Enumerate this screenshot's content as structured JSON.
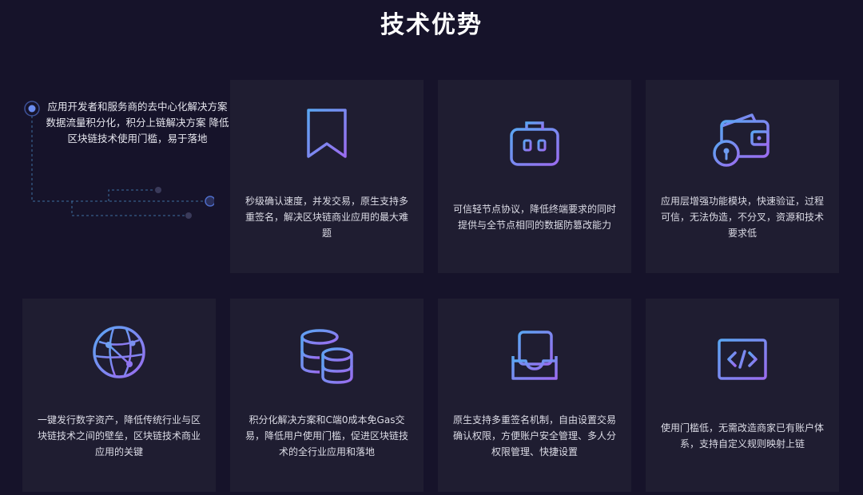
{
  "title": "技术优势",
  "intro": "应用开发者和服务商的去中心化解决方案 数据流量积分化，积分上链解决方案 降低区块链技术使用门槛，易于落地",
  "cards": [
    {
      "icon": "bookmark-icon",
      "text": "秒级确认速度，并发交易，原生支持多重签名，解决区块链商业应用的最大难题"
    },
    {
      "icon": "briefcase-icon",
      "text": "可信轻节点协议，降低终端要求的同时提供与全节点相同的数据防篡改能力"
    },
    {
      "icon": "wallet-lock-icon",
      "text": "应用层增强功能模块，快速验证，过程可信，无法伪造，不分叉，资源和技术要求低"
    },
    {
      "icon": "globe-network-icon",
      "text": "一键发行数字资产，降低传统行业与区块链技术之间的壁垒，区块链技术商业应用的关键"
    },
    {
      "icon": "database-icon",
      "text": "积分化解决方案和C端0成本免Gas交易，降低用户使用门槛，促进区块链技术的全行业应用和落地"
    },
    {
      "icon": "inbox-document-icon",
      "text": "原生支持多重签名机制，自由设置交易确认权限，方便账户安全管理、多人分权限管理、快捷设置"
    },
    {
      "icon": "code-monitor-icon",
      "text": "使用门槛低，无需改造商家已有账户体系，支持自定义规则映射上链"
    }
  ],
  "colors": {
    "background": "#16132a",
    "card": "#1f1d31",
    "icon_gradient_start": "#5aa0f0",
    "icon_gradient_end": "#9a6cf0"
  }
}
